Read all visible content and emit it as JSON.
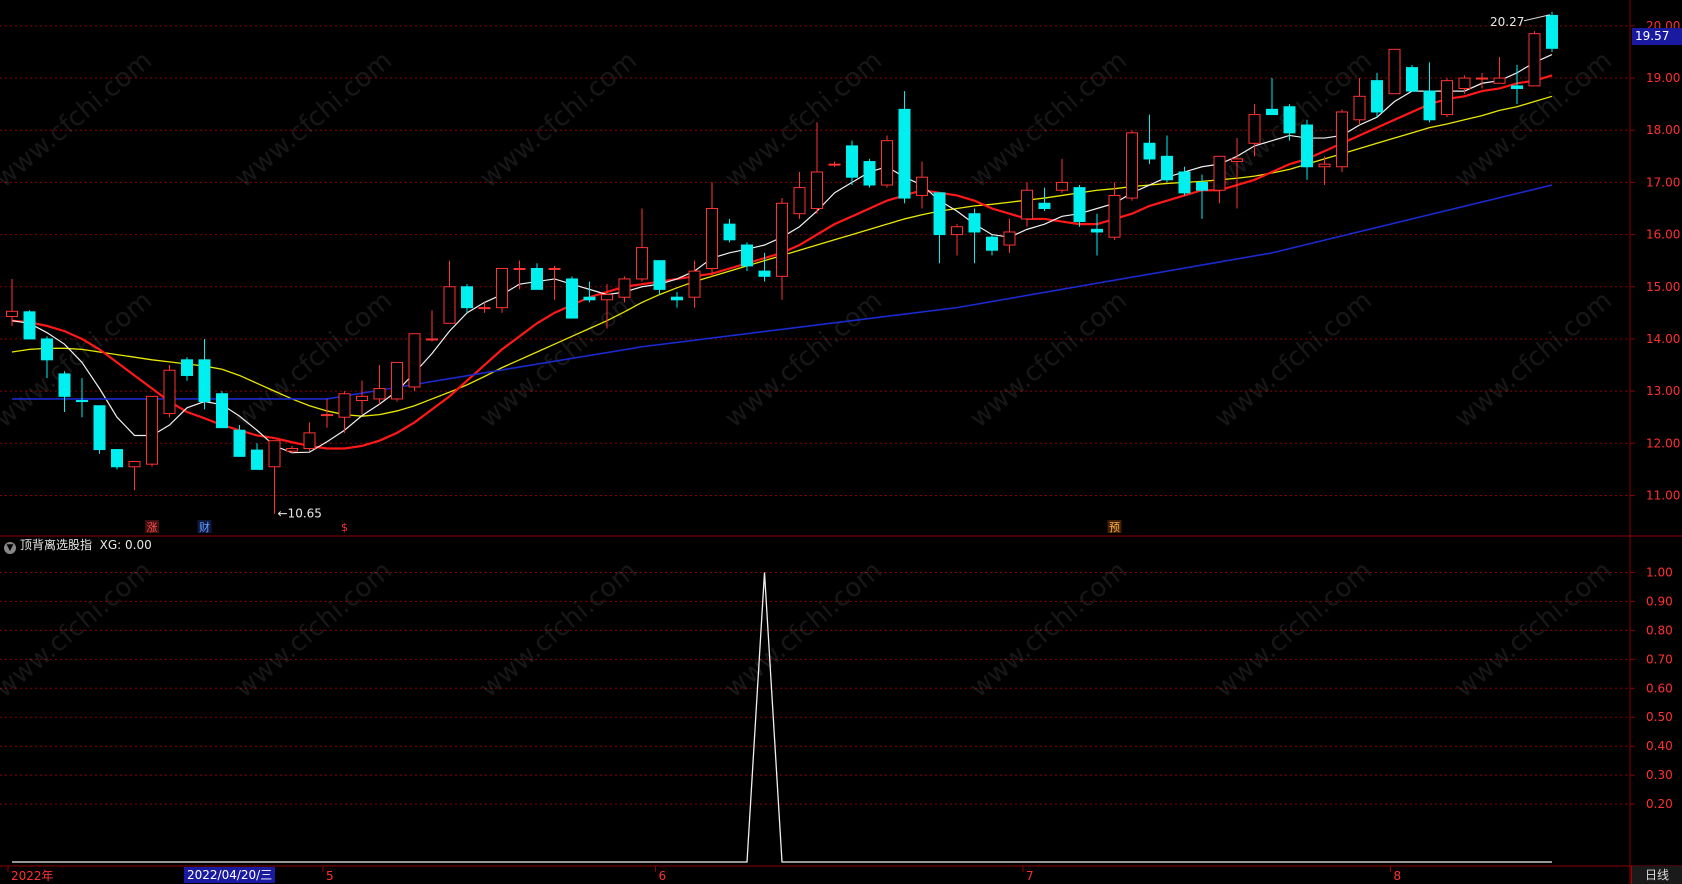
{
  "indicator": {
    "name": "顶背离选股指",
    "xg_label": "XG: 0.00"
  },
  "period_label": "日线",
  "cursor_date": "2022/04/20/三",
  "last_price": "19.57",
  "low_label": "←10.65",
  "high_label": "20.27",
  "watermark": "www.cfchi.com",
  "x_labels": [
    {
      "i": 0,
      "t": "2022年"
    },
    {
      "i": 18,
      "t": "5"
    },
    {
      "i": 37,
      "t": "6"
    },
    {
      "i": 58,
      "t": "7"
    },
    {
      "i": 79,
      "t": "8"
    }
  ],
  "markers": [
    {
      "i": 8,
      "t": "涨",
      "color": "#ff5050",
      "bg": "#401010"
    },
    {
      "i": 11,
      "t": "财",
      "color": "#60a0ff",
      "bg": "#101840"
    },
    {
      "i": 19,
      "t": "$",
      "color": "#ff3030",
      "bg": "#000"
    },
    {
      "i": 63,
      "t": "预",
      "color": "#ffb040",
      "bg": "#402008"
    }
  ],
  "colors": {
    "up": "#ff3232",
    "down": "#00f0f0",
    "ma5": "#f0f0f0",
    "ma10": "#ff1818",
    "ma30": "#e8e800",
    "ma60": "#1a2ad0",
    "grid": "#8b0000",
    "axis_text": "#ff3030"
  },
  "chart_data": {
    "type": "candlestick",
    "price_axis": {
      "ylim": [
        10.3,
        20.4
      ],
      "ticks": [
        20.0,
        19.0,
        18.0,
        17.0,
        16.0,
        15.0,
        14.0,
        13.0,
        12.0,
        11.0
      ]
    },
    "indicator_axis": {
      "ylim": [
        0,
        1.05
      ],
      "ticks": [
        1.0,
        0.9,
        0.8,
        0.7,
        0.6,
        0.5,
        0.4,
        0.3,
        0.2
      ]
    },
    "candles": [
      {
        "o": 14.43,
        "h": 15.15,
        "l": 14.25,
        "c": 14.53
      },
      {
        "o": 14.52,
        "h": 14.55,
        "l": 14.0,
        "c": 14.0
      },
      {
        "o": 14.0,
        "h": 14.05,
        "l": 13.25,
        "c": 13.6
      },
      {
        "o": 13.33,
        "h": 13.38,
        "l": 12.6,
        "c": 12.9
      },
      {
        "o": 12.82,
        "h": 13.25,
        "l": 12.5,
        "c": 12.8
      },
      {
        "o": 12.72,
        "h": 12.72,
        "l": 11.8,
        "c": 11.88
      },
      {
        "o": 11.88,
        "h": 11.88,
        "l": 11.5,
        "c": 11.55
      },
      {
        "o": 11.55,
        "h": 11.65,
        "l": 11.1,
        "c": 11.65
      },
      {
        "o": 11.6,
        "h": 12.8,
        "l": 11.55,
        "c": 12.9
      },
      {
        "o": 12.57,
        "h": 13.5,
        "l": 12.5,
        "c": 13.4
      },
      {
        "o": 13.6,
        "h": 13.65,
        "l": 13.2,
        "c": 13.3
      },
      {
        "o": 13.6,
        "h": 14.0,
        "l": 12.65,
        "c": 12.8
      },
      {
        "o": 12.95,
        "h": 13.0,
        "l": 12.3,
        "c": 12.3
      },
      {
        "o": 12.25,
        "h": 12.35,
        "l": 11.75,
        "c": 11.75
      },
      {
        "o": 11.87,
        "h": 12.0,
        "l": 11.5,
        "c": 11.5
      },
      {
        "o": 11.55,
        "h": 12.05,
        "l": 10.65,
        "c": 12.05
      },
      {
        "o": 11.85,
        "h": 11.95,
        "l": 11.8,
        "c": 11.9
      },
      {
        "o": 11.9,
        "h": 12.4,
        "l": 11.85,
        "c": 12.2
      },
      {
        "o": 12.55,
        "h": 12.85,
        "l": 12.3,
        "c": 12.55
      },
      {
        "o": 12.5,
        "h": 13.0,
        "l": 12.2,
        "c": 12.95
      },
      {
        "o": 12.82,
        "h": 13.2,
        "l": 12.55,
        "c": 12.9
      },
      {
        "o": 12.85,
        "h": 13.5,
        "l": 12.75,
        "c": 13.05
      },
      {
        "o": 12.85,
        "h": 13.55,
        "l": 12.8,
        "c": 13.55
      },
      {
        "o": 13.08,
        "h": 14.1,
        "l": 13.0,
        "c": 14.1
      },
      {
        "o": 14.0,
        "h": 14.55,
        "l": 13.95,
        "c": 14.0
      },
      {
        "o": 14.3,
        "h": 15.5,
        "l": 14.3,
        "c": 15.0
      },
      {
        "o": 15.0,
        "h": 15.05,
        "l": 14.5,
        "c": 14.6
      },
      {
        "o": 14.6,
        "h": 14.7,
        "l": 14.5,
        "c": 14.6
      },
      {
        "o": 14.6,
        "h": 15.3,
        "l": 14.5,
        "c": 15.35
      },
      {
        "o": 15.35,
        "h": 15.5,
        "l": 14.95,
        "c": 15.35
      },
      {
        "o": 15.35,
        "h": 15.45,
        "l": 14.95,
        "c": 14.95
      },
      {
        "o": 15.35,
        "h": 15.4,
        "l": 14.75,
        "c": 15.35
      },
      {
        "o": 15.15,
        "h": 15.2,
        "l": 14.4,
        "c": 14.4
      },
      {
        "o": 14.8,
        "h": 15.1,
        "l": 14.7,
        "c": 14.75
      },
      {
        "o": 14.75,
        "h": 15.05,
        "l": 14.2,
        "c": 14.85
      },
      {
        "o": 14.8,
        "h": 15.2,
        "l": 14.7,
        "c": 15.15
      },
      {
        "o": 15.15,
        "h": 16.5,
        "l": 15.1,
        "c": 15.75
      },
      {
        "o": 15.5,
        "h": 15.5,
        "l": 14.85,
        "c": 14.95
      },
      {
        "o": 14.8,
        "h": 14.9,
        "l": 14.6,
        "c": 14.75
      },
      {
        "o": 14.8,
        "h": 15.5,
        "l": 14.6,
        "c": 15.3
      },
      {
        "o": 15.35,
        "h": 17.0,
        "l": 15.2,
        "c": 16.5
      },
      {
        "o": 16.2,
        "h": 16.3,
        "l": 15.85,
        "c": 15.9
      },
      {
        "o": 15.8,
        "h": 15.85,
        "l": 15.3,
        "c": 15.4
      },
      {
        "o": 15.3,
        "h": 15.65,
        "l": 15.1,
        "c": 15.2
      },
      {
        "o": 15.2,
        "h": 16.7,
        "l": 14.75,
        "c": 16.6
      },
      {
        "o": 16.4,
        "h": 17.2,
        "l": 16.3,
        "c": 16.9
      },
      {
        "o": 16.5,
        "h": 18.15,
        "l": 16.4,
        "c": 17.2
      },
      {
        "o": 17.35,
        "h": 17.4,
        "l": 17.3,
        "c": 17.35
      },
      {
        "o": 17.7,
        "h": 17.8,
        "l": 16.95,
        "c": 17.1
      },
      {
        "o": 17.4,
        "h": 17.45,
        "l": 16.9,
        "c": 16.95
      },
      {
        "o": 16.95,
        "h": 17.9,
        "l": 16.9,
        "c": 17.8
      },
      {
        "o": 18.4,
        "h": 18.75,
        "l": 16.6,
        "c": 16.7
      },
      {
        "o": 16.75,
        "h": 17.4,
        "l": 16.5,
        "c": 17.1
      },
      {
        "o": 16.8,
        "h": 16.8,
        "l": 15.45,
        "c": 16.0
      },
      {
        "o": 16.0,
        "h": 16.2,
        "l": 15.6,
        "c": 16.15
      },
      {
        "o": 16.4,
        "h": 16.5,
        "l": 15.45,
        "c": 16.05
      },
      {
        "o": 15.95,
        "h": 16.0,
        "l": 15.6,
        "c": 15.7
      },
      {
        "o": 15.8,
        "h": 16.3,
        "l": 15.65,
        "c": 16.05
      },
      {
        "o": 16.3,
        "h": 17.0,
        "l": 16.15,
        "c": 16.85
      },
      {
        "o": 16.6,
        "h": 16.9,
        "l": 16.45,
        "c": 16.5
      },
      {
        "o": 16.85,
        "h": 17.45,
        "l": 16.8,
        "c": 17.0
      },
      {
        "o": 16.9,
        "h": 16.95,
        "l": 16.15,
        "c": 16.25
      },
      {
        "o": 16.1,
        "h": 16.4,
        "l": 15.6,
        "c": 16.05
      },
      {
        "o": 15.95,
        "h": 17.0,
        "l": 15.9,
        "c": 16.75
      },
      {
        "o": 16.7,
        "h": 18.0,
        "l": 16.65,
        "c": 17.95
      },
      {
        "o": 17.75,
        "h": 18.3,
        "l": 17.35,
        "c": 17.45
      },
      {
        "o": 17.5,
        "h": 17.9,
        "l": 17.0,
        "c": 17.05
      },
      {
        "o": 17.2,
        "h": 17.3,
        "l": 16.75,
        "c": 16.8
      },
      {
        "o": 17.0,
        "h": 17.15,
        "l": 16.3,
        "c": 16.85
      },
      {
        "o": 16.85,
        "h": 17.5,
        "l": 16.6,
        "c": 17.5
      },
      {
        "o": 17.4,
        "h": 17.85,
        "l": 16.5,
        "c": 17.45
      },
      {
        "o": 17.75,
        "h": 18.5,
        "l": 17.5,
        "c": 18.3
      },
      {
        "o": 18.4,
        "h": 19.0,
        "l": 18.3,
        "c": 18.3
      },
      {
        "o": 18.45,
        "h": 18.5,
        "l": 17.8,
        "c": 17.95
      },
      {
        "o": 18.1,
        "h": 18.2,
        "l": 17.05,
        "c": 17.3
      },
      {
        "o": 17.3,
        "h": 17.5,
        "l": 16.95,
        "c": 17.35
      },
      {
        "o": 17.3,
        "h": 18.4,
        "l": 17.2,
        "c": 18.35
      },
      {
        "o": 18.2,
        "h": 19.0,
        "l": 18.1,
        "c": 18.65
      },
      {
        "o": 18.95,
        "h": 19.1,
        "l": 18.25,
        "c": 18.35
      },
      {
        "o": 18.7,
        "h": 19.55,
        "l": 18.7,
        "c": 19.55
      },
      {
        "o": 19.2,
        "h": 19.25,
        "l": 18.75,
        "c": 18.75
      },
      {
        "o": 18.75,
        "h": 19.3,
        "l": 18.15,
        "c": 18.2
      },
      {
        "o": 18.3,
        "h": 19.0,
        "l": 18.25,
        "c": 18.95
      },
      {
        "o": 18.8,
        "h": 19.05,
        "l": 18.7,
        "c": 19.0
      },
      {
        "o": 19.0,
        "h": 19.1,
        "l": 18.8,
        "c": 19.0
      },
      {
        "o": 18.9,
        "h": 19.4,
        "l": 18.9,
        "c": 19.0
      },
      {
        "o": 18.85,
        "h": 19.25,
        "l": 18.5,
        "c": 18.8
      },
      {
        "o": 18.85,
        "h": 19.9,
        "l": 18.85,
        "c": 19.85
      },
      {
        "o": 20.2,
        "h": 20.27,
        "l": 19.5,
        "c": 19.57
      }
    ],
    "ma5": [
      14.35,
      14.3,
      14.12,
      13.9,
      13.55,
      13.05,
      12.5,
      12.15,
      12.15,
      12.35,
      12.68,
      12.8,
      12.74,
      12.52,
      12.25,
      11.95,
      11.82,
      11.83,
      12.03,
      12.25,
      12.53,
      12.75,
      13.0,
      13.35,
      13.72,
      14.15,
      14.5,
      14.7,
      14.85,
      15.05,
      15.1,
      15.15,
      15.05,
      14.95,
      14.85,
      14.9,
      15.0,
      15.05,
      15.15,
      15.3,
      15.55,
      15.65,
      15.72,
      15.8,
      15.95,
      16.15,
      16.45,
      16.8,
      17.0,
      17.2,
      17.3,
      17.1,
      16.95,
      16.65,
      16.45,
      16.2,
      16.0,
      15.95,
      16.1,
      16.2,
      16.35,
      16.4,
      16.5,
      16.6,
      16.8,
      16.95,
      17.1,
      17.2,
      17.3,
      17.35,
      17.5,
      17.7,
      17.8,
      17.9,
      17.85,
      17.85,
      17.9,
      18.1,
      18.25,
      18.55,
      18.75,
      18.75,
      18.75,
      18.75,
      18.9,
      18.95,
      19.1,
      19.3,
      19.45
    ],
    "ma10": [
      14.35,
      14.32,
      14.25,
      14.15,
      14.0,
      13.8,
      13.55,
      13.3,
      13.05,
      12.8,
      12.6,
      12.48,
      12.35,
      12.25,
      12.15,
      12.1,
      12.02,
      11.95,
      11.9,
      11.9,
      11.95,
      12.05,
      12.2,
      12.4,
      12.65,
      12.9,
      13.2,
      13.5,
      13.8,
      14.05,
      14.3,
      14.5,
      14.65,
      14.8,
      14.9,
      15.0,
      15.05,
      15.1,
      15.15,
      15.2,
      15.25,
      15.35,
      15.45,
      15.55,
      15.65,
      15.8,
      16.0,
      16.2,
      16.35,
      16.5,
      16.65,
      16.75,
      16.85,
      16.8,
      16.75,
      16.65,
      16.5,
      16.4,
      16.3,
      16.3,
      16.25,
      16.2,
      16.2,
      16.3,
      16.4,
      16.55,
      16.65,
      16.75,
      16.85,
      16.85,
      16.95,
      17.05,
      17.2,
      17.35,
      17.45,
      17.6,
      17.75,
      17.9,
      18.05,
      18.2,
      18.35,
      18.5,
      18.6,
      18.65,
      18.75,
      18.8,
      18.9,
      18.95,
      19.05
    ],
    "ma30": [
      13.75,
      13.8,
      13.82,
      13.82,
      13.8,
      13.75,
      13.7,
      13.65,
      13.6,
      13.56,
      13.52,
      13.48,
      13.42,
      13.3,
      13.15,
      13.0,
      12.85,
      12.72,
      12.62,
      12.55,
      12.52,
      12.55,
      12.62,
      12.72,
      12.85,
      12.98,
      13.12,
      13.28,
      13.45,
      13.6,
      13.75,
      13.9,
      14.05,
      14.2,
      14.35,
      14.52,
      14.7,
      14.85,
      14.98,
      15.1,
      15.2,
      15.3,
      15.4,
      15.5,
      15.6,
      15.7,
      15.8,
      15.9,
      16.0,
      16.1,
      16.2,
      16.3,
      16.38,
      16.45,
      16.5,
      16.55,
      16.58,
      16.62,
      16.66,
      16.7,
      16.75,
      16.8,
      16.85,
      16.88,
      16.92,
      16.95,
      16.98,
      17.0,
      17.02,
      17.05,
      17.08,
      17.12,
      17.18,
      17.25,
      17.35,
      17.45,
      17.55,
      17.65,
      17.75,
      17.85,
      17.95,
      18.05,
      18.12,
      18.2,
      18.28,
      18.38,
      18.45,
      18.55,
      18.65
    ],
    "ma60": {
      "x": [
        0,
        18,
        36,
        54,
        72,
        88
      ],
      "y": [
        12.85,
        12.85,
        13.85,
        14.6,
        15.65,
        16.95
      ]
    },
    "indicator": {
      "series": "XG",
      "spike_index": 43,
      "spike_value": 1.0,
      "base_value": 0.0
    }
  }
}
